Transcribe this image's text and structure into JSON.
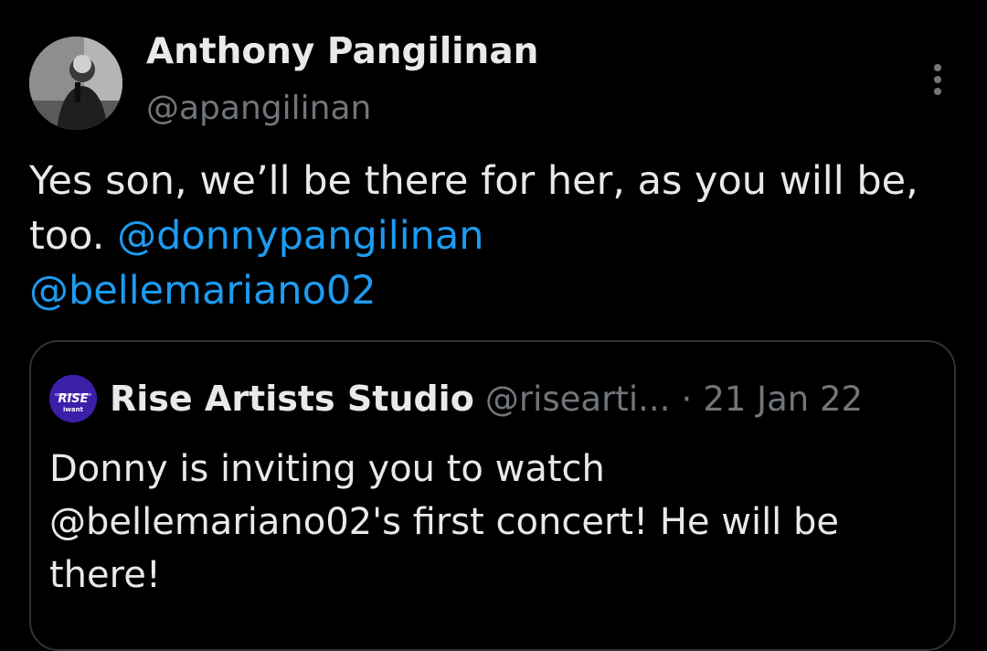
{
  "tweet": {
    "author": {
      "name": "Anthony Pangilinan",
      "handle": "@apangilinan"
    },
    "text_segments": {
      "plain": "Yes son, we’ll be there for her, as you will be, too. ",
      "mention_1": "@donnypangilinan",
      "mention_2": "@bellemariano02"
    },
    "more_icon": "more-vertical-icon"
  },
  "quote": {
    "author": {
      "name": "Rise Artists Studio",
      "handle": "@risearti...",
      "avatar_text": "RISE",
      "avatar_subtext": "iwant"
    },
    "separator": "·",
    "date": "21 Jan 22",
    "text": "Donny is inviting you to watch @bellemariano02's first concert! He will be there!"
  },
  "colors": {
    "background": "#000000",
    "text_primary": "#e7e9ea",
    "text_secondary": "#71767b",
    "link": "#1d9bf0",
    "border": "#2f3336"
  }
}
